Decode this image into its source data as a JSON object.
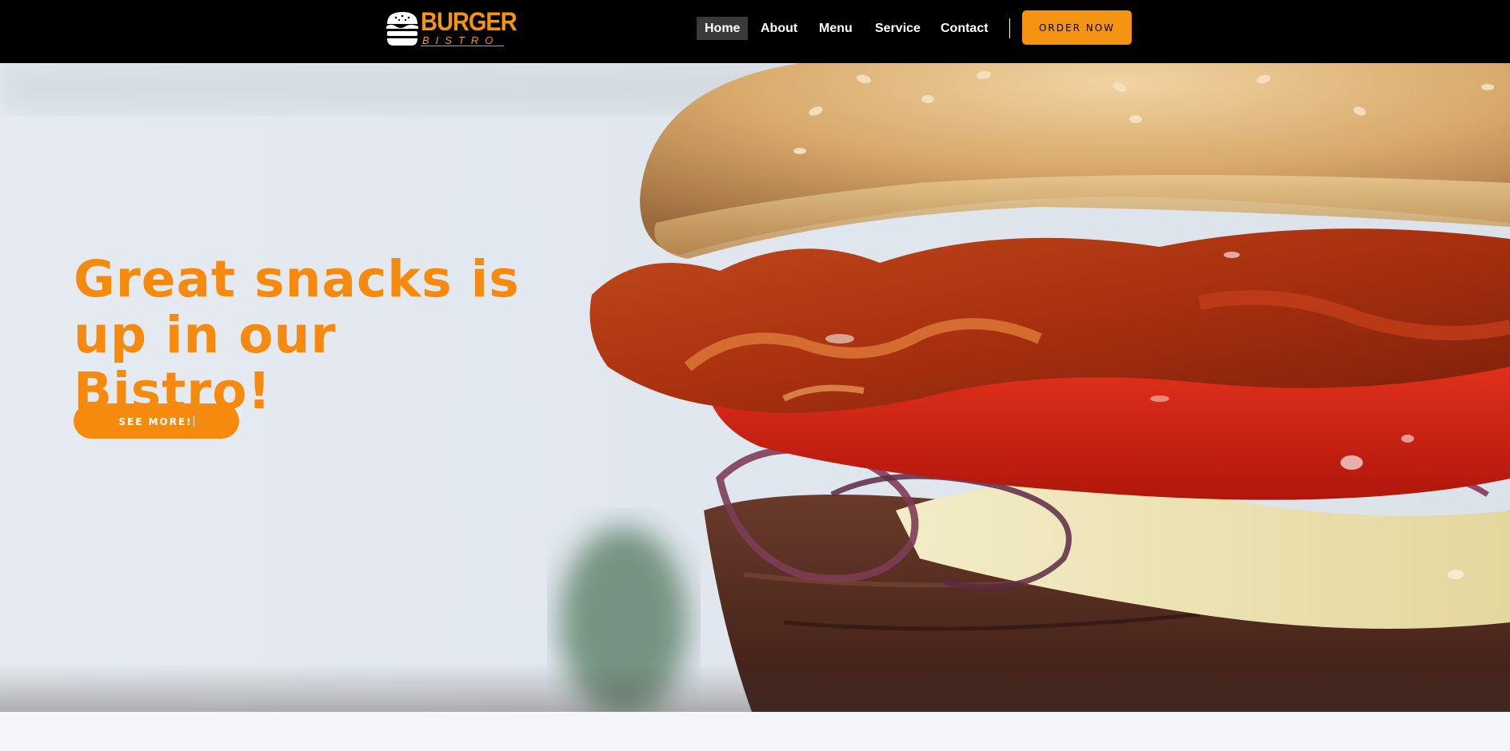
{
  "brand": {
    "name_top": "BURGER",
    "name_bottom": "BISTRO",
    "accent_color": "#f59313"
  },
  "nav": {
    "items": [
      {
        "label": "Home",
        "active": true
      },
      {
        "label": "About",
        "active": false
      },
      {
        "label": "Menu",
        "active": false
      },
      {
        "label": "Service",
        "active": false
      },
      {
        "label": "Contact",
        "active": false
      }
    ],
    "order_button": "ORDER NOW"
  },
  "hero": {
    "title_line1": "Great snacks is",
    "title_line2": "up in our Bistro!",
    "cta_label": "SEE MORE!",
    "image": "burger-closeup-photo"
  },
  "icons": {
    "logo": "burger-icon"
  }
}
